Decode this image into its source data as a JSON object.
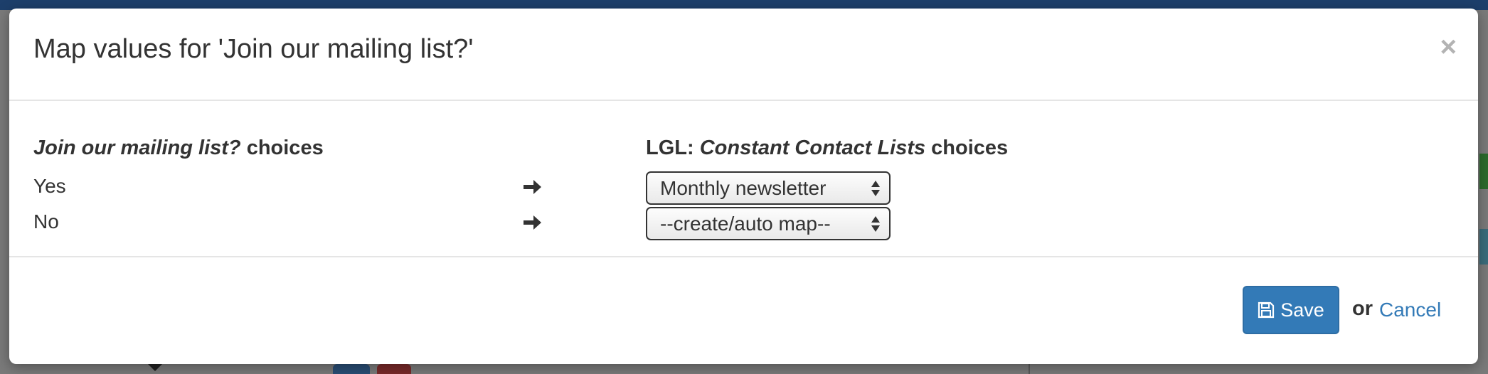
{
  "modal": {
    "title": "Map values for 'Join our mailing list?'",
    "close_label": "×"
  },
  "mapping": {
    "left_header_field": "Join our mailing list?",
    "left_header_suffix": " choices",
    "right_header_prefix": "LGL: ",
    "right_header_field": "Constant Contact Lists",
    "right_header_suffix": " choices",
    "rows": [
      {
        "label": "Yes",
        "selected": "Monthly newsletter"
      },
      {
        "label": "No",
        "selected": "--create/auto map--"
      }
    ]
  },
  "footer": {
    "save_label": "Save",
    "or_text": "or",
    "cancel_label": "Cancel"
  },
  "icons": {
    "close": "close-icon",
    "arrow": "arrow-right-icon",
    "save": "floppy-disk-icon",
    "select": "updown-caret-icon"
  },
  "colors": {
    "primary": "#337ab7",
    "text": "#333333",
    "divider": "#e5e5e5"
  }
}
